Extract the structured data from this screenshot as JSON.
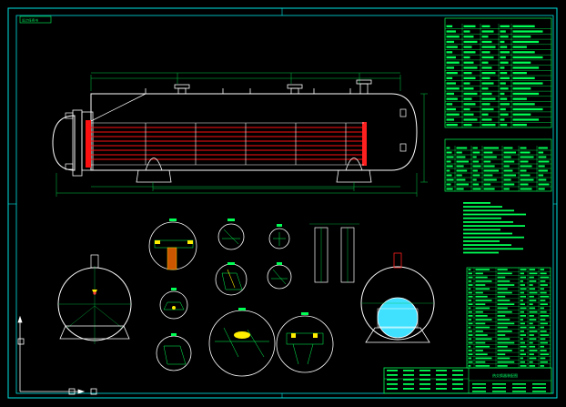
{
  "drawing": {
    "corner_tag": "设计任务书",
    "title_block_name": "热交换器装配图",
    "colors": {
      "background": "#000000",
      "frame": "#00e5e5",
      "outline": "#ffffff",
      "tubes": "#ff1010",
      "tables": "#00ff55",
      "dimension": "#00cc44",
      "cut_section": "#ffff00",
      "shell_fill": "#40e0ff",
      "yellow_accent": "#ffee00"
    },
    "icons": [
      "ucs-axis-icon",
      "model-space-icon"
    ]
  }
}
